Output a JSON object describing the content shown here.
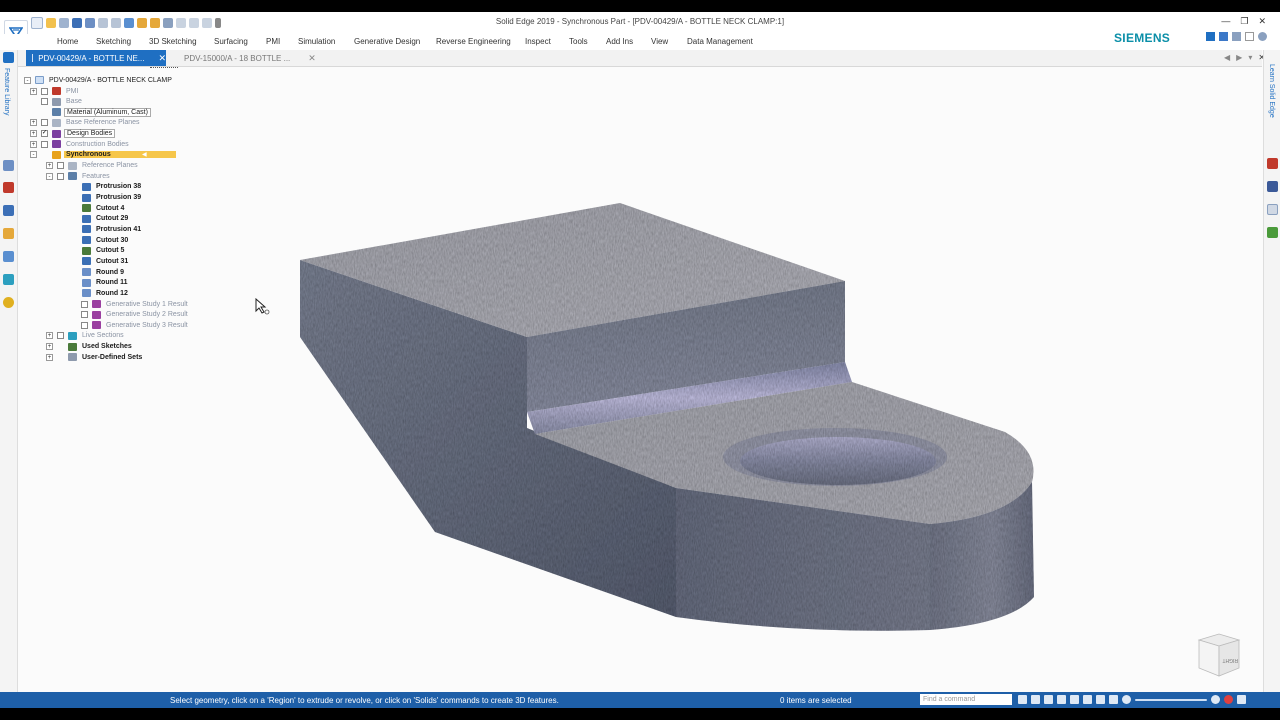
{
  "window": {
    "title": "Solid Edge 2019 - Synchronous Part - [PDV-00429/A - BOTTLE NECK CLAMP:1]",
    "brand": "SIEMENS",
    "brand_color": "#0b8fa8",
    "accent_color": "#1f6fc2"
  },
  "menu": [
    "Home",
    "Sketching",
    "3D Sketching",
    "Surfacing",
    "PMI",
    "Simulation",
    "Generative Design",
    "Reverse Engineering",
    "Inspect",
    "Tools",
    "Add Ins",
    "View",
    "Data Management"
  ],
  "tabs": [
    {
      "label": "PDV-00429/A - BOTTLE NE...",
      "active": true
    },
    {
      "label": "PDV-15000/A - 18 BOTTLE ...",
      "active": false
    }
  ],
  "left_panel_label": "Feature Library",
  "right_panel_label": "Learn Solid Edge",
  "tree": {
    "root": "PDV-00429/A - BOTTLE NECK CLAMP",
    "nodes": [
      {
        "label": "PMI",
        "expander": "+",
        "checkbox": true,
        "checked": false,
        "style": "dim",
        "indent": 0,
        "icon": "#c0392b"
      },
      {
        "label": "Base",
        "expander": "",
        "checkbox": true,
        "checked": false,
        "style": "dim",
        "indent": 0,
        "icon": "#8e9aad"
      },
      {
        "label": "Material (Aluminum, Cast)",
        "expander": "",
        "checkbox": false,
        "checked": false,
        "style": "box",
        "indent": 0,
        "icon": "#5c7fa8"
      },
      {
        "label": "Base Reference Planes",
        "expander": "+",
        "checkbox": true,
        "checked": false,
        "style": "dim",
        "indent": 0,
        "icon": "#aab4c4"
      },
      {
        "label": "Design Bodies",
        "expander": "+",
        "checkbox": true,
        "checked": true,
        "style": "box",
        "indent": 0,
        "icon": "#7b3fa0"
      },
      {
        "label": "Construction Bodies",
        "expander": "+",
        "checkbox": true,
        "checked": false,
        "style": "dim",
        "indent": 0,
        "icon": "#7b3fa0"
      },
      {
        "label": "Synchronous",
        "expander": "-",
        "checkbox": false,
        "checked": false,
        "style": "hl",
        "indent": 0,
        "icon": "#e8a21c"
      },
      {
        "label": "Reference Planes",
        "expander": "+",
        "checkbox": true,
        "checked": false,
        "style": "dim",
        "indent": 1,
        "icon": "#aab4c4"
      },
      {
        "label": "Features",
        "expander": "-",
        "checkbox": true,
        "checked": false,
        "style": "dim",
        "indent": 1,
        "icon": "#5c7fa8"
      },
      {
        "label": "Protrusion 38",
        "expander": "",
        "checkbox": false,
        "checked": false,
        "style": "bold",
        "indent": 2,
        "icon": "#3b6fb5"
      },
      {
        "label": "Protrusion 39",
        "expander": "",
        "checkbox": false,
        "checked": false,
        "style": "bold",
        "indent": 2,
        "icon": "#3b6fb5"
      },
      {
        "label": "Cutout 4",
        "expander": "",
        "checkbox": false,
        "checked": false,
        "style": "bold",
        "indent": 2,
        "icon": "#4a7a3a"
      },
      {
        "label": "Cutout 29",
        "expander": "",
        "checkbox": false,
        "checked": false,
        "style": "bold",
        "indent": 2,
        "icon": "#3b6fb5"
      },
      {
        "label": "Protrusion 41",
        "expander": "",
        "checkbox": false,
        "checked": false,
        "style": "bold",
        "indent": 2,
        "icon": "#3b6fb5"
      },
      {
        "label": "Cutout 30",
        "expander": "",
        "checkbox": false,
        "checked": false,
        "style": "bold",
        "indent": 2,
        "icon": "#3b6fb5"
      },
      {
        "label": "Cutout 5",
        "expander": "",
        "checkbox": false,
        "checked": false,
        "style": "bold",
        "indent": 2,
        "icon": "#4a7a3a"
      },
      {
        "label": "Cutout 31",
        "expander": "",
        "checkbox": false,
        "checked": false,
        "style": "bold",
        "indent": 2,
        "icon": "#3b6fb5"
      },
      {
        "label": "Round 9",
        "expander": "",
        "checkbox": false,
        "checked": false,
        "style": "bold",
        "indent": 2,
        "icon": "#6a8fc8"
      },
      {
        "label": "Round 11",
        "expander": "",
        "checkbox": false,
        "checked": false,
        "style": "bold",
        "indent": 2,
        "icon": "#6a8fc8"
      },
      {
        "label": "Round 12",
        "expander": "",
        "checkbox": false,
        "checked": false,
        "style": "bold",
        "indent": 2,
        "icon": "#6a8fc8"
      },
      {
        "label": "Generative Study 1 Result",
        "expander": "",
        "checkbox": true,
        "checked": false,
        "style": "dim",
        "indent": 3,
        "icon": "#9a3fa0"
      },
      {
        "label": "Generative Study 2 Result",
        "expander": "",
        "checkbox": true,
        "checked": false,
        "style": "dim",
        "indent": 3,
        "icon": "#9a3fa0"
      },
      {
        "label": "Generative Study 3 Result",
        "expander": "",
        "checkbox": true,
        "checked": false,
        "style": "dim",
        "indent": 3,
        "icon": "#9a3fa0"
      },
      {
        "label": "Live Sections",
        "expander": "+",
        "checkbox": true,
        "checked": false,
        "style": "dim",
        "indent": 1,
        "icon": "#2c9fbf"
      },
      {
        "label": "Used Sketches",
        "expander": "+",
        "checkbox": false,
        "checked": false,
        "style": "bold",
        "indent": 1,
        "icon": "#4a7a3a"
      },
      {
        "label": "User-Defined Sets",
        "expander": "+",
        "checkbox": false,
        "checked": false,
        "style": "bold",
        "indent": 1,
        "icon": "#8e9aad"
      }
    ]
  },
  "status": {
    "prompt": "Select geometry, click on a 'Region' to extrude or revolve, or click on 'Solids' commands to create 3D features.",
    "selection": "0 items are selected",
    "command_placeholder": "Find a command"
  },
  "viewcube_label": "RIGHT"
}
